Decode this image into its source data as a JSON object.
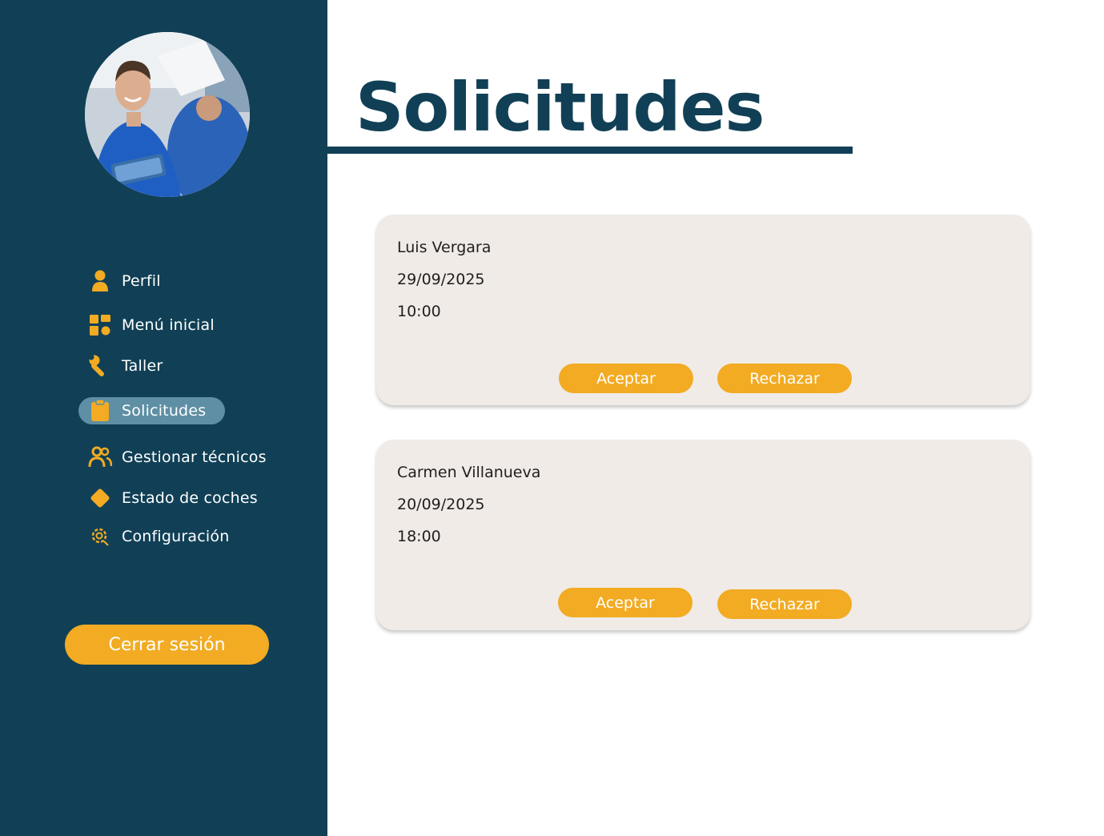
{
  "sidebar": {
    "profile_photo": "mechanic-photo",
    "items": [
      {
        "label": "Perfil",
        "icon": "user-icon"
      },
      {
        "label": "Menú inicial",
        "icon": "grid-icon"
      },
      {
        "label": "Taller",
        "icon": "wrench-icon"
      },
      {
        "label": "Solicitudes",
        "icon": "clipboard-icon",
        "active": true
      },
      {
        "label": "Gestionar técnicos",
        "icon": "users-icon"
      },
      {
        "label": "Estado de coches",
        "icon": "diamond-icon"
      },
      {
        "label": "Configuración",
        "icon": "gear-icon"
      }
    ],
    "logout_label": "Cerrar sesión"
  },
  "main": {
    "title": "Solicitudes",
    "requests": [
      {
        "name": "Luis Vergara",
        "date": "29/09/2025",
        "time": "10:00",
        "accept_label": "Aceptar",
        "reject_label": "Rechazar"
      },
      {
        "name": "Carmen Villanueva",
        "date": "20/09/2025",
        "time": "18:00",
        "accept_label": "Aceptar",
        "reject_label": "Rechazar"
      }
    ]
  },
  "colors": {
    "sidebar_bg": "#114056",
    "accent": "#f2ab22",
    "active_item_bg": "#5e8fa4",
    "card_bg": "#f0ebe7"
  }
}
